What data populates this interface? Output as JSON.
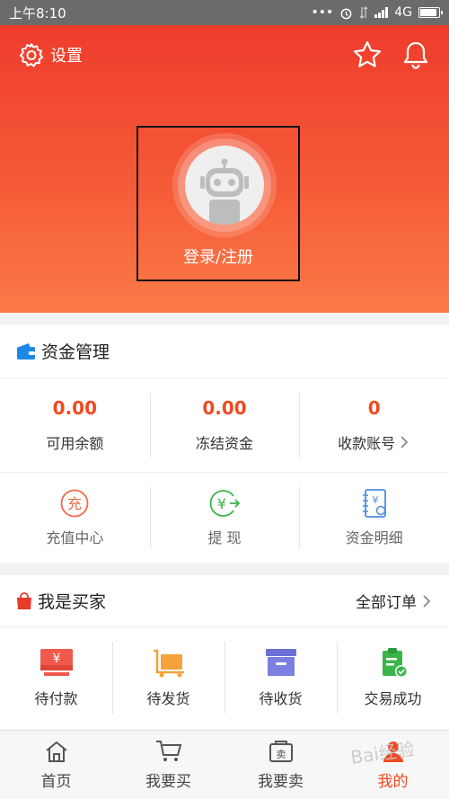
{
  "status_bar": {
    "time": "上午8:10",
    "network": "4G",
    "battery_level": 0.8
  },
  "header": {
    "settings_label": "设置",
    "login_label": "登录/注册"
  },
  "funds": {
    "title": "资金管理",
    "stats": [
      {
        "value": "0.00",
        "label": "可用余额"
      },
      {
        "value": "0.00",
        "label": "冻结资金"
      },
      {
        "value": "0",
        "label": "收款账号"
      }
    ],
    "actions": [
      {
        "label": "充值中心",
        "glyph": "充"
      },
      {
        "label": "提  现",
        "glyph": "¥"
      },
      {
        "label": "资金明细",
        "glyph": "¥"
      }
    ]
  },
  "buyer": {
    "title": "我是买家",
    "all_orders": "全部订单",
    "items": [
      {
        "label": "待付款",
        "glyph": "¥"
      },
      {
        "label": "待发货"
      },
      {
        "label": "待收货"
      },
      {
        "label": "交易成功"
      }
    ]
  },
  "tabbar": {
    "tabs": [
      {
        "label": "首页"
      },
      {
        "label": "我要买"
      },
      {
        "label": "我要卖",
        "glyph": "卖"
      },
      {
        "label": "我的"
      }
    ]
  },
  "watermark": "Bai经验",
  "colors": {
    "accent": "#f04a22",
    "header_top": "#ef3c2c",
    "header_bottom": "#fb7a47",
    "blue": "#1e88e5",
    "green": "#3bb54a"
  }
}
